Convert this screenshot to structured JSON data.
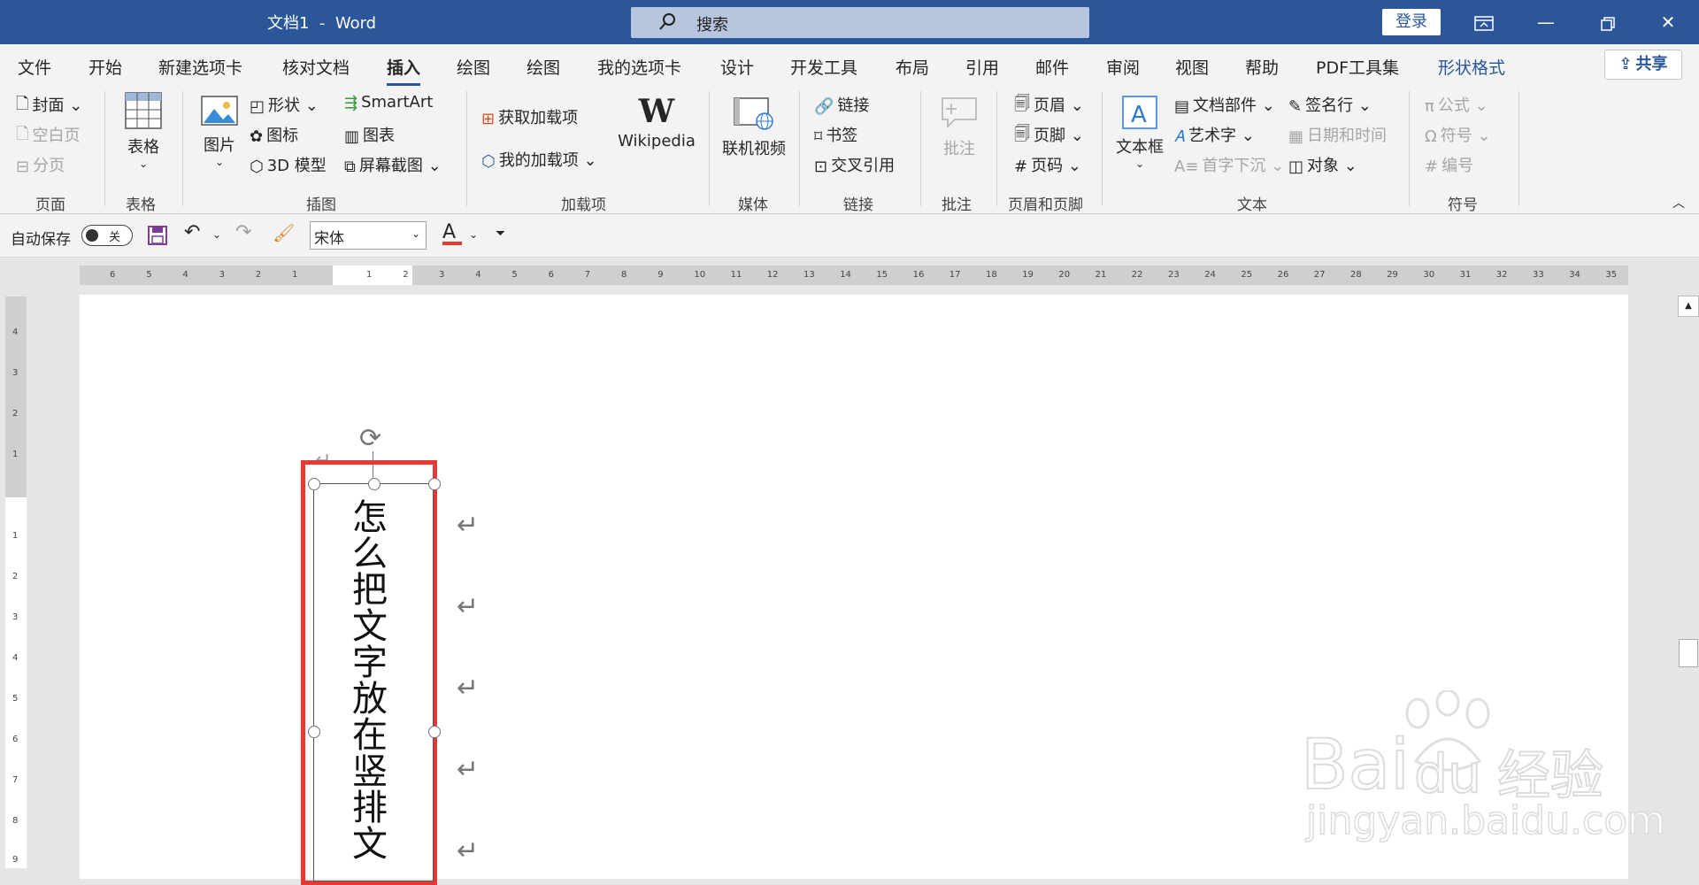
{
  "window": {
    "title": "文档1  -  Word",
    "search_placeholder": "搜索",
    "login": "登录"
  },
  "tabs": [
    "文件",
    "开始",
    "新建选项卡",
    "核对文档",
    "插入",
    "绘图",
    "绘图",
    "我的选项卡",
    "设计",
    "开发工具",
    "布局",
    "引用",
    "邮件",
    "审阅",
    "视图",
    "帮助",
    "PDF工具集",
    "形状格式"
  ],
  "active_tab": "插入",
  "share_label": "共享",
  "ribbon": {
    "page": {
      "cover": "封面",
      "blank": "空白页",
      "break": "分页",
      "group": "页面"
    },
    "table": {
      "label": "表格",
      "group": "表格"
    },
    "illustrations": {
      "pictures": "图片",
      "shapes": "形状",
      "icons": "图标",
      "model3d": "3D 模型",
      "smartart": "SmartArt",
      "chart": "图表",
      "screenshot": "屏幕截图",
      "group": "插图"
    },
    "addins": {
      "get": "获取加载项",
      "mine": "我的加载项",
      "wikipedia": "Wikipedia",
      "group": "加载项"
    },
    "media": {
      "video": "联机视频",
      "group": "媒体"
    },
    "links": {
      "link": "链接",
      "bookmark": "书签",
      "crossref": "交叉引用",
      "group": "链接"
    },
    "comments": {
      "comment": "批注",
      "group": "批注"
    },
    "headerfooter": {
      "header": "页眉",
      "footer": "页脚",
      "pagenum": "页码",
      "group": "页眉和页脚"
    },
    "text": {
      "textbox": "文本框",
      "quickparts": "文档部件",
      "wordart": "艺术字",
      "dropcap": "首字下沉",
      "sigline": "签名行",
      "datetime": "日期和时间",
      "object": "对象",
      "group": "文本"
    },
    "symbols": {
      "equation": "公式",
      "symbol": "符号",
      "number": "编号",
      "group": "符号"
    }
  },
  "qat": {
    "autosave": "自动保存",
    "toggle": "关",
    "font": "宋体",
    "font_color_letter": "A"
  },
  "document": {
    "vertical_text": [
      "怎",
      "么",
      "把",
      "文",
      "字",
      "放",
      "在",
      "竖",
      "排",
      "文"
    ]
  },
  "watermark": {
    "brand": "Bai",
    "brand2": "du",
    "brand_cn": "经验",
    "url": "jingyan.baidu.com"
  },
  "colors": {
    "brand": "#2b579a",
    "highlight": "#e53935"
  },
  "ruler": {
    "left_numbers": [
      "6",
      "5",
      "4",
      "3",
      "2",
      "1"
    ],
    "white": [
      "1",
      "2"
    ],
    "right_numbers": [
      "3",
      "4",
      "5",
      "6",
      "7",
      "8",
      "9",
      "10",
      "11",
      "12",
      "13",
      "14",
      "15",
      "16",
      "17",
      "18",
      "19",
      "20",
      "21",
      "22",
      "23",
      "24",
      "25",
      "26",
      "27",
      "28",
      "29",
      "30",
      "31",
      "32",
      "33",
      "34",
      "35"
    ]
  }
}
